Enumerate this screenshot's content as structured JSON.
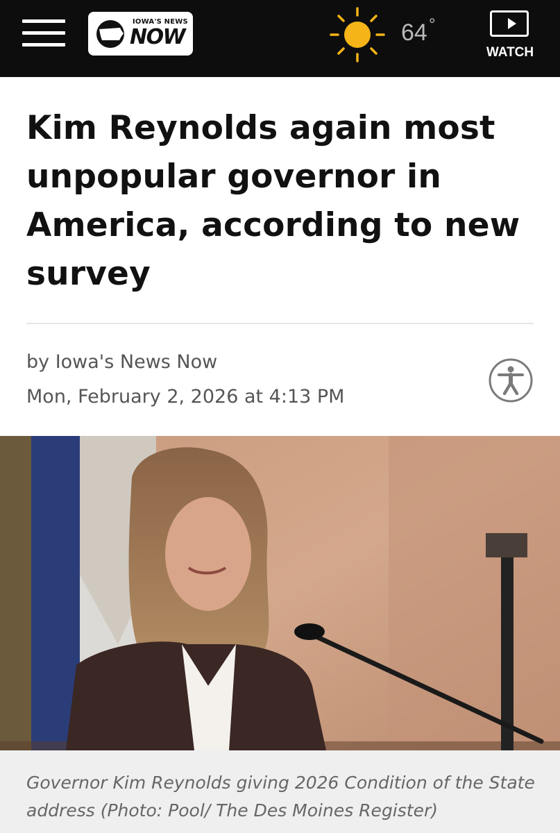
{
  "header": {
    "menu_icon": "hamburger-menu-icon",
    "logo": {
      "small_text": "IOWA'S NEWS",
      "big_text": "NOW",
      "icon": "iowa-map-icon"
    },
    "weather": {
      "icon": "sun-icon",
      "temperature": "64",
      "degree_symbol": "°"
    },
    "watch": {
      "icon": "play-video-icon",
      "label": "WATCH"
    }
  },
  "article": {
    "headline": "Kim Reynolds again most unpopular governor in America, according to new survey",
    "byline": "by Iowa's News Now",
    "date": "Mon, February 2, 2026 at 4:13 PM",
    "accessibility_icon": "accessibility-icon",
    "photo": {
      "caption": "Governor Kim Reynolds giving 2026 Condition of the State address (Photo: Pool/ The Des Moines Register)"
    }
  },
  "colors": {
    "topbar": "#0d0d0d",
    "sun": "#f5b418",
    "caption_bg": "#efefef",
    "divider": "#e6e6e6"
  }
}
